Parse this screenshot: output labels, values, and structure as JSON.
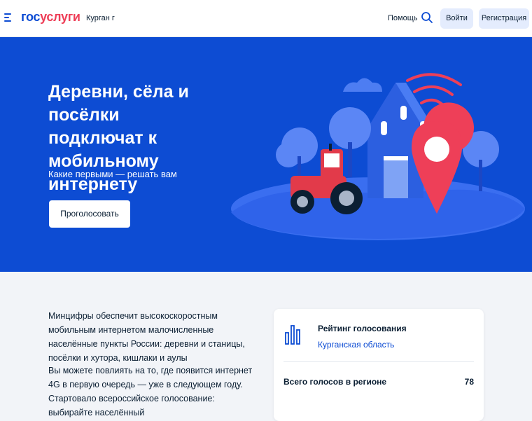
{
  "header": {
    "logo_part1": "гос",
    "logo_part2": "услуги",
    "region": "Курган г",
    "help": "Помощь",
    "login": "Войти",
    "register": "Регистрация"
  },
  "hero": {
    "title_line1": "Деревни, сёла и посёлки",
    "title_line2": "подключат к мобильному",
    "title_line3": "интернету",
    "subtitle": "Какие первыми — решать вам",
    "vote_button": "Проголосовать"
  },
  "content": {
    "paragraph1": "Минцифры обеспечит высокоскоростным мобильным интернетом малочисленные населённые пункты России: деревни и станицы, посёлки и хутора, кишлаки и аулы",
    "paragraph2": "Вы можете повлиять на то, где появится интернет 4G в первую очередь — уже в следующем году. Стартовало всероссийское голосование: выбирайте населённый"
  },
  "rating_card": {
    "title": "Рейтинг голосования",
    "region": "Курганская область",
    "total_label": "Всего голосов в регионе",
    "total_value": "78"
  },
  "colors": {
    "brand_blue": "#0d4cd3",
    "brand_red": "#ee3f58",
    "hero_bg": "#0d4cd3",
    "button_bg": "#e4ecfd"
  },
  "icons": [
    "menu-icon",
    "search-icon",
    "chart-icon"
  ]
}
